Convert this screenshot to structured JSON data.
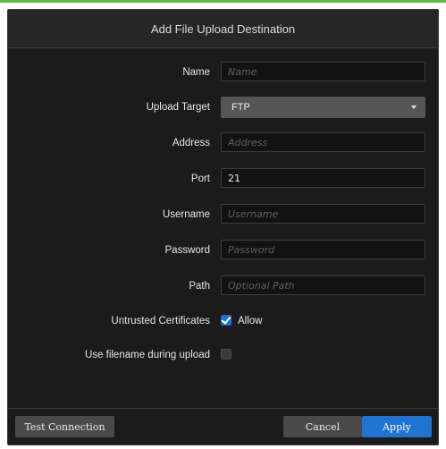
{
  "dialog": {
    "title": "Add File Upload Destination"
  },
  "form": {
    "name": {
      "label": "Name",
      "value": "",
      "placeholder": "Name"
    },
    "upload_target": {
      "label": "Upload Target",
      "selected": "FTP"
    },
    "address": {
      "label": "Address",
      "value": "",
      "placeholder": "Address"
    },
    "port": {
      "label": "Port",
      "value": "21",
      "placeholder": ""
    },
    "username": {
      "label": "Username",
      "value": "",
      "placeholder": "Username"
    },
    "password": {
      "label": "Password",
      "value": "",
      "placeholder": "Password"
    },
    "path": {
      "label": "Path",
      "value": "",
      "placeholder": "Optional Path"
    },
    "untrusted_certificates": {
      "label": "Untrusted Certificates",
      "checked": true,
      "option_label": "Allow"
    },
    "use_filename": {
      "label": "Use filename during upload",
      "checked": false
    }
  },
  "footer": {
    "test_connection": "Test Connection",
    "cancel": "Cancel",
    "apply": "Apply"
  },
  "colors": {
    "accent": "#1f73d1",
    "background": "#1b1b1b",
    "top_strip": "#5cbf3a"
  },
  "icons": {
    "dropdown": "chevron-down-icon",
    "check": "checkmark-icon"
  }
}
